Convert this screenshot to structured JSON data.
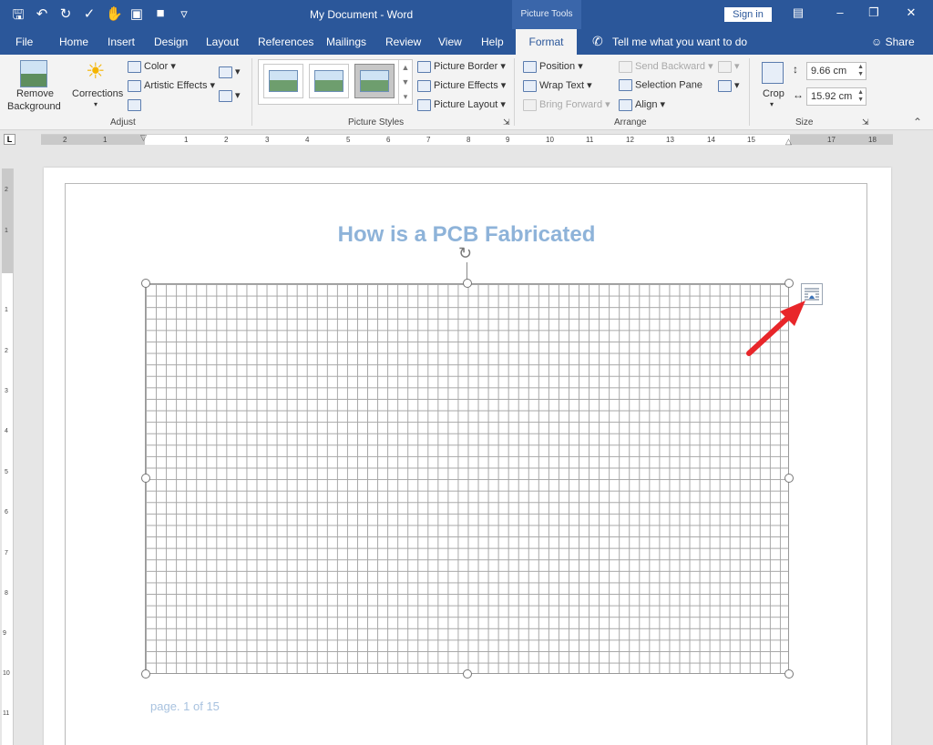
{
  "titlebar": {
    "doc_title": "My Document  -  Word",
    "context_label": "Picture Tools",
    "sign_in": "Sign in"
  },
  "tabs": [
    "File",
    "Home",
    "Insert",
    "Design",
    "Layout",
    "References",
    "Mailings",
    "Review",
    "View",
    "Help"
  ],
  "active_tab": "Format",
  "tell_me": "Tell me what you want to do",
  "share": "Share",
  "ribbon": {
    "adjust": {
      "remove_background_1": "Remove",
      "remove_background_2": "Background",
      "corrections": "Corrections",
      "color": "Color",
      "artistic_effects": "Artistic Effects",
      "group_label": "Adjust"
    },
    "picture_styles": {
      "picture_border": "Picture Border",
      "picture_effects": "Picture Effects",
      "picture_layout": "Picture Layout",
      "group_label": "Picture Styles"
    },
    "arrange": {
      "position": "Position",
      "wrap_text": "Wrap Text",
      "bring_forward": "Bring Forward",
      "send_backward": "Send Backward",
      "selection_pane": "Selection Pane",
      "align": "Align",
      "group_label": "Arrange"
    },
    "size": {
      "crop": "Crop",
      "height": "9.66 cm",
      "width": "15.92 cm",
      "group_label": "Size"
    }
  },
  "ruler_numbers": [
    "2",
    "1",
    "1",
    "2",
    "3",
    "4",
    "5",
    "6",
    "7",
    "8",
    "9",
    "10",
    "11",
    "12",
    "13",
    "14",
    "15",
    "17",
    "18"
  ],
  "vruler_numbers": [
    "2",
    "1",
    "1",
    "2",
    "3",
    "4",
    "5",
    "6",
    "7",
    "8",
    "9",
    "10",
    "11"
  ],
  "document": {
    "heading": "How is a PCB Fabricated",
    "footer": "page. 1 of 15"
  },
  "colors": {
    "word_blue": "#2b579a",
    "heading": "#8eb3d9",
    "arrow": "#e8262a"
  }
}
